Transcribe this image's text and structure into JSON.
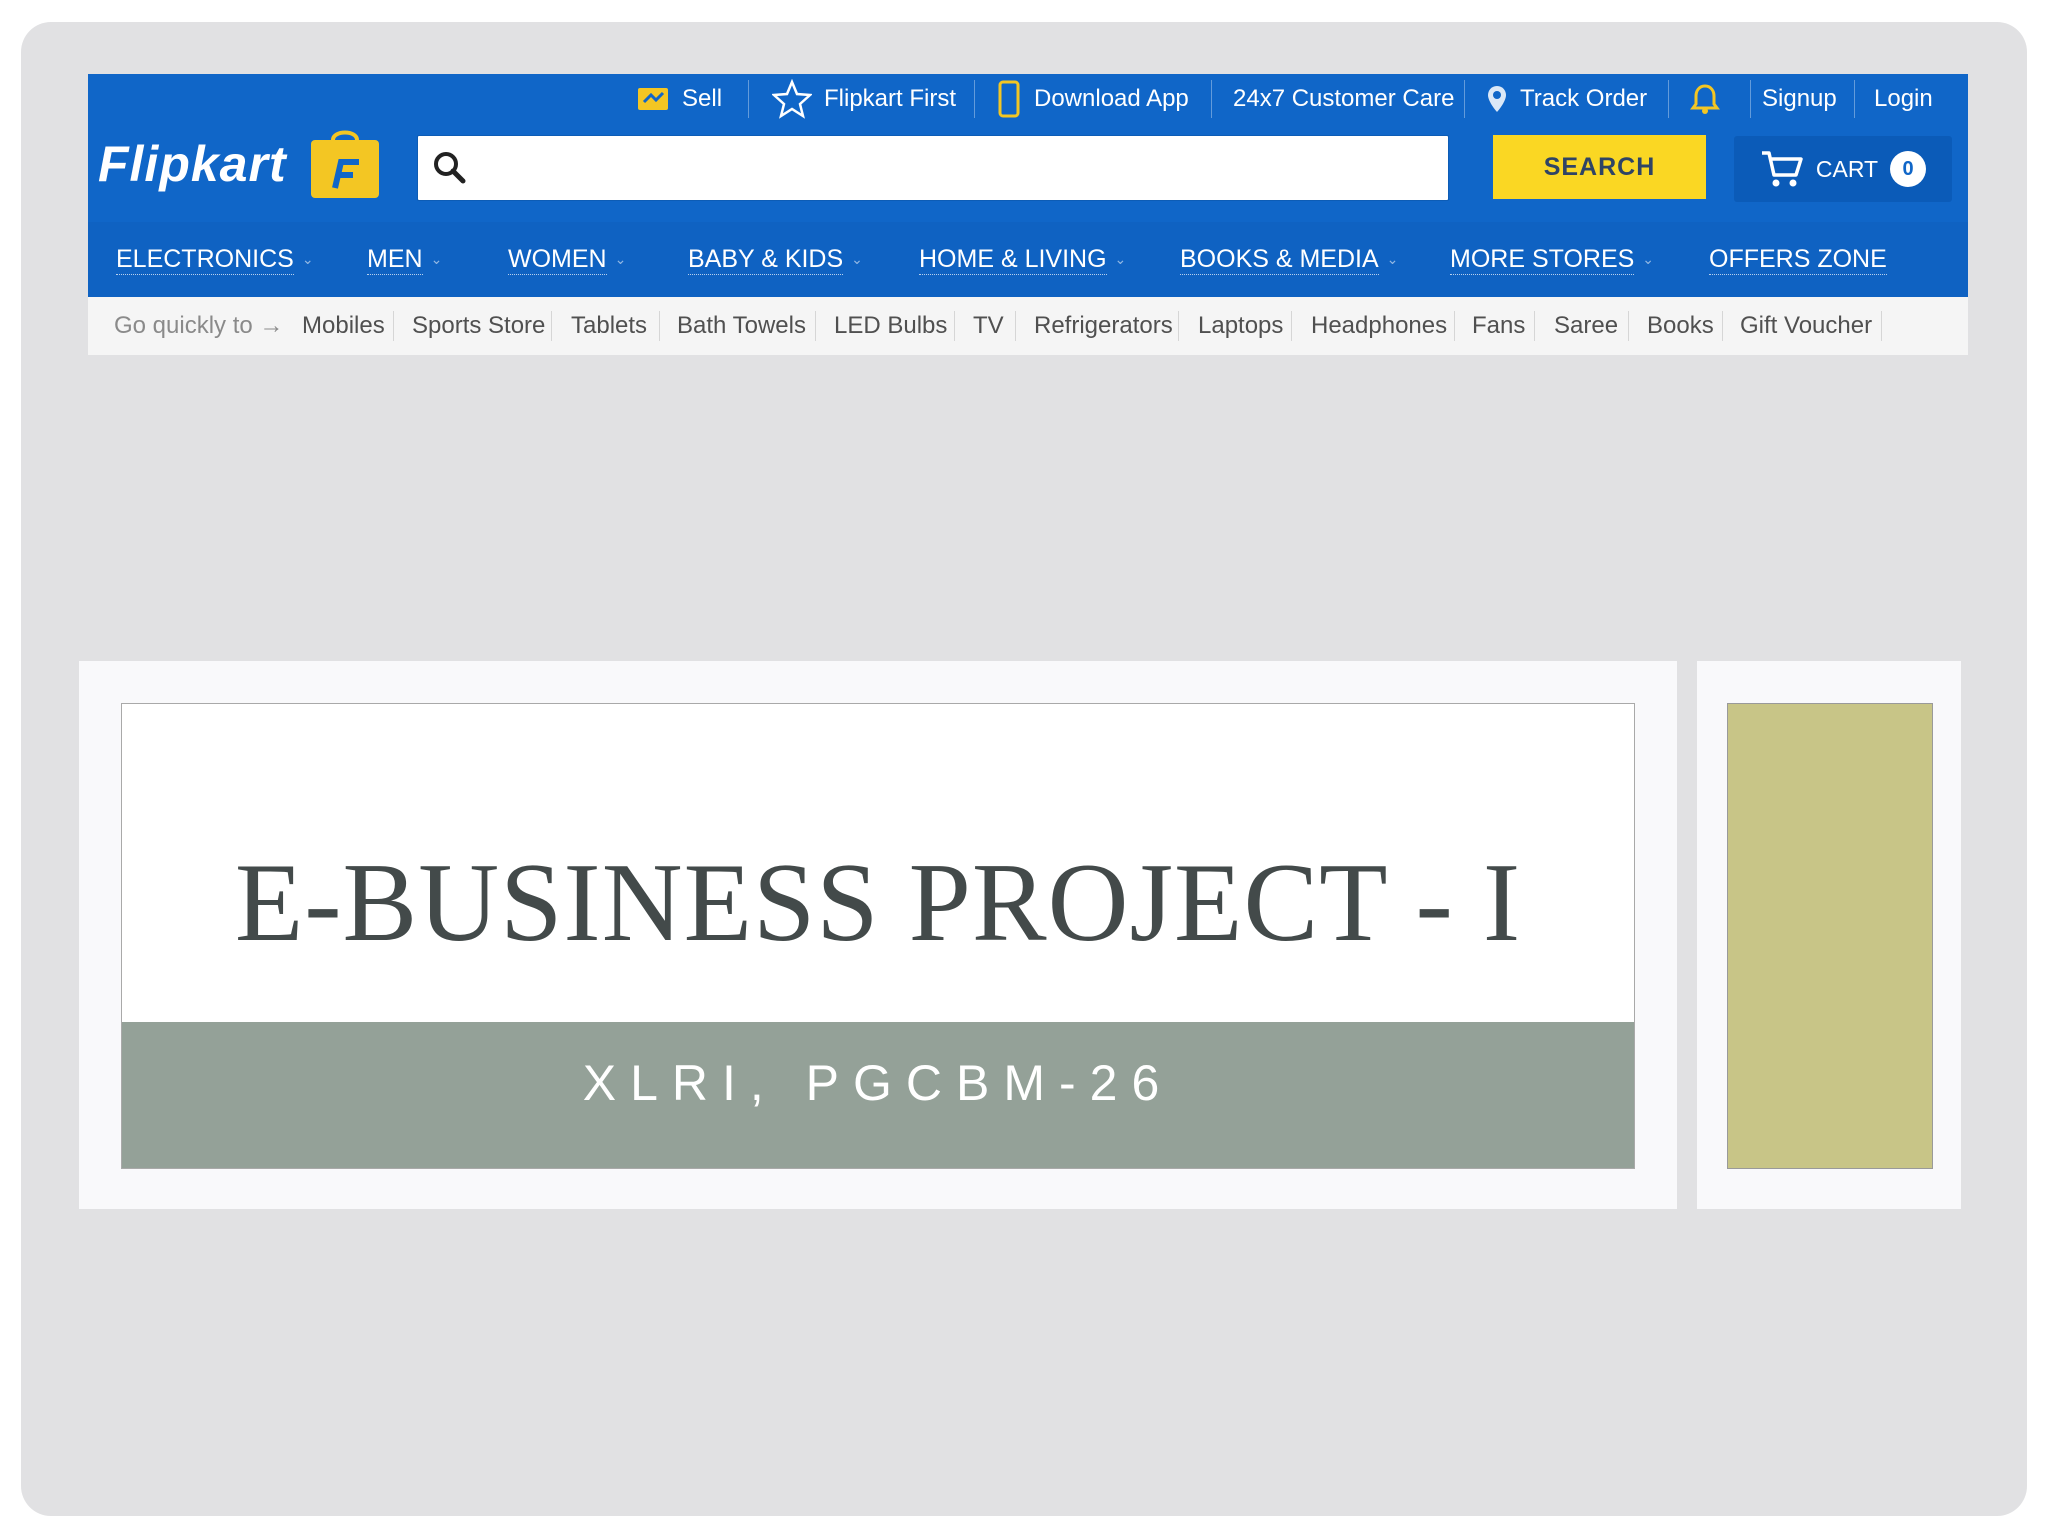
{
  "header": {
    "top_links": {
      "sell": "Sell",
      "flipkart_first": "Flipkart First",
      "download_app": "Download App",
      "customer_care": "24x7 Customer Care",
      "track_order": "Track Order",
      "signup": "Signup",
      "login": "Login"
    },
    "logo_text": "Flipkart",
    "search": {
      "placeholder": "",
      "value": "",
      "button_label": "SEARCH"
    },
    "cart": {
      "label": "CART",
      "count": "0"
    }
  },
  "categories": [
    "ELECTRONICS",
    "MEN",
    "WOMEN",
    "BABY & KIDS",
    "HOME & LIVING",
    "BOOKS & MEDIA",
    "MORE STORES",
    "OFFERS ZONE"
  ],
  "quick_links": {
    "label": "Go quickly to",
    "items": [
      "Mobiles",
      "Sports Store",
      "Tablets",
      "Bath Towels",
      "LED Bulbs",
      "TV",
      "Refrigerators",
      "Laptops",
      "Headphones",
      "Fans",
      "Saree",
      "Books",
      "Gift Voucher"
    ]
  },
  "slide": {
    "title": "E-BUSINESS PROJECT - I",
    "subtitle": "XLRI, PGCBM-26"
  },
  "colors": {
    "brand_blue": "#1066c8",
    "search_yellow": "#fad723",
    "subtitle_band": "#94a198",
    "side_panel": "#c8c587",
    "slide_background": "#e1e1e3"
  }
}
